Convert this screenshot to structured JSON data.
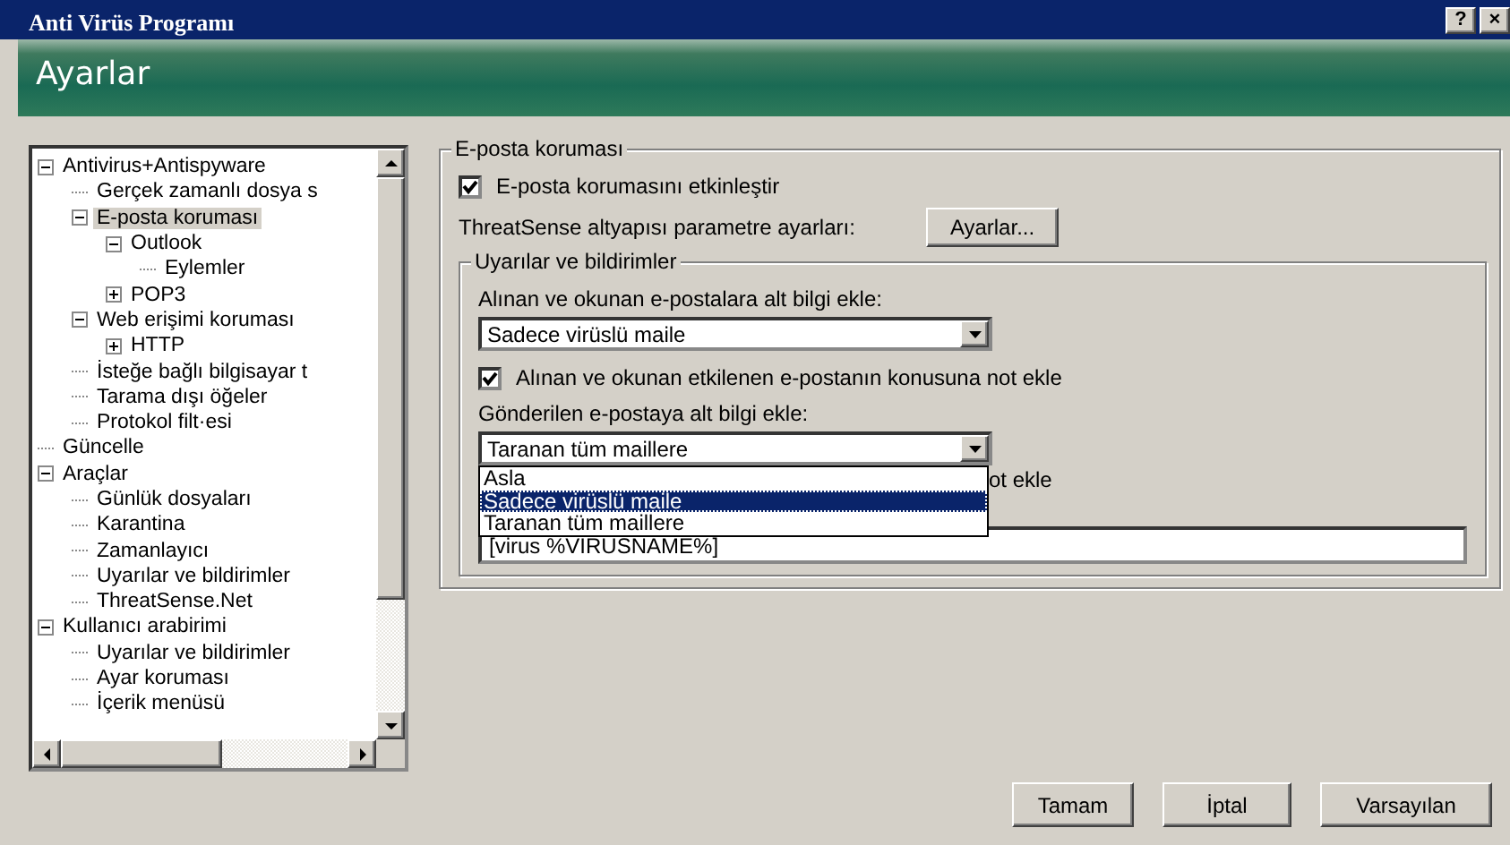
{
  "window": {
    "title": "Anti Virüs Programı",
    "buttons": [
      "?",
      "×"
    ]
  },
  "header": {
    "title": "Ayarlar"
  },
  "tree": [
    {
      "label": "Antivirus+Antispyware",
      "expanded": true,
      "selected": false,
      "children": [
        {
          "label": "Gerçek zamanlı dosya s",
          "selected": false
        },
        {
          "label": "E-posta koruması",
          "expanded": true,
          "selected": true,
          "children": [
            {
              "label": "Outlook",
              "expanded": true,
              "selected": false,
              "children": [
                {
                  "label": "Eylemler",
                  "selected": false
                }
              ]
            },
            {
              "label": "POP3",
              "expanded": false,
              "selected": false
            }
          ]
        },
        {
          "label": "Web erişimi koruması",
          "expanded": true,
          "selected": false,
          "children": [
            {
              "label": "HTTP",
              "expanded": false,
              "selected": false
            }
          ]
        },
        {
          "label": "İsteğe bağlı bilgisayar t",
          "selected": false
        },
        {
          "label": "Tarama dışı öğeler",
          "selected": false
        },
        {
          "label": "Protokol filt·esi",
          "selected": false
        }
      ]
    },
    {
      "label": "Güncelle",
      "selected": false
    },
    {
      "label": "Araçlar",
      "expanded": true,
      "selected": false,
      "children": [
        {
          "label": "Günlük dosyaları",
          "selected": false
        },
        {
          "label": "Karantina",
          "selected": false
        },
        {
          "label": "Zamanlayıcı",
          "selected": false
        },
        {
          "label": "Uyarılar ve bildirimler",
          "selected": false
        },
        {
          "label": "ThreatSense.Net",
          "selected": false
        }
      ]
    },
    {
      "label": "Kullanıcı arabirimi",
      "expanded": true,
      "selected": false,
      "children": [
        {
          "label": "Uyarılar ve bildirimler",
          "selected": false
        },
        {
          "label": "Ayar koruması",
          "selected": false
        },
        {
          "label": "İçerik menüsü",
          "selected": false
        }
      ]
    }
  ],
  "email_protection": {
    "legend": "E-posta koruması",
    "enable": {
      "label": "E-posta korumasını etkinleştir",
      "checked": true
    },
    "threatsense_label": "ThreatSense altyapısı parametre ayarları:",
    "threatsense_button": "Ayarlar...",
    "alerts": {
      "legend": "Uyarılar ve bildirimler",
      "received_label": "Alınan ve okunan e-postalara alt bilgi ekle:",
      "received_value": "Sadece virüslü maile",
      "subject_note": {
        "label": "Alınan ve okunan etkilenen e-postanın konusuna not ekle",
        "checked": true
      },
      "sent_label": "Gönderilen e-postaya alt bilgi ekle:",
      "sent_value": "Taranan tüm maillere",
      "sent_options": [
        {
          "label": "Asla",
          "selected": false
        },
        {
          "label": "Sadece virüslü maile",
          "selected": true
        },
        {
          "label": "Taranan tüm maillere",
          "selected": false
        }
      ],
      "covered_fragment": "ot ekle",
      "template_value": "[virus %VIRUSNAME%]"
    }
  },
  "buttons": [
    "Tamam",
    "İptal",
    "Varsayılan"
  ]
}
